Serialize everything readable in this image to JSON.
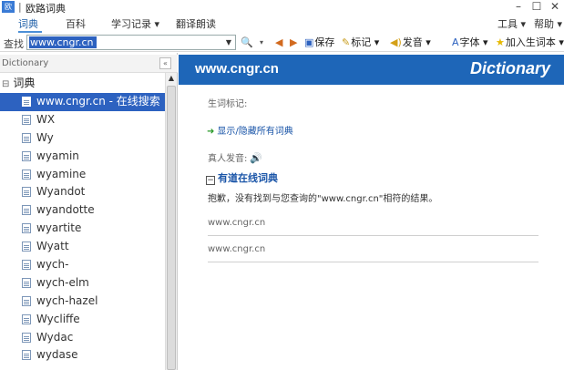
{
  "window": {
    "app_icon_text": "欧",
    "separator": "|",
    "title": "欧路词典",
    "minimize": "–",
    "maximize": "☐",
    "close": "✕"
  },
  "menubar": {
    "tabs": [
      {
        "label": "词典"
      },
      {
        "label": "百科"
      },
      {
        "label": "学习记录 ▾"
      },
      {
        "label": "翻译朗读"
      }
    ],
    "tools": "工具 ▾",
    "help": "帮助 ▾"
  },
  "toolbar": {
    "search_label": "查找",
    "search_value": "www.cngr.cn",
    "search_dropdown": "▼",
    "search_icon": "🔍",
    "search_icon_arrow": "▾",
    "back_icon": "◀",
    "forward_icon": "▶",
    "save": "保存",
    "mark": "标记 ▾",
    "pronounce": "发音 ▾",
    "font": "字体 ▾",
    "add_wordbook": "加入生词本 ▾"
  },
  "left_panel": {
    "title": "Dictionary",
    "collapse_icon": "«",
    "root_toggle": "⊟",
    "root_label": "词典",
    "items": [
      {
        "label": "www.cngr.cn - 在线搜索",
        "selected": true
      },
      {
        "label": "WX"
      },
      {
        "label": "Wy"
      },
      {
        "label": "wyamin"
      },
      {
        "label": "wyamine"
      },
      {
        "label": "Wyandot"
      },
      {
        "label": "wyandotte"
      },
      {
        "label": "wyartite"
      },
      {
        "label": "Wyatt"
      },
      {
        "label": "wych-"
      },
      {
        "label": "wych-elm"
      },
      {
        "label": "wych-hazel"
      },
      {
        "label": "Wycliffe"
      },
      {
        "label": "Wydac"
      },
      {
        "label": "wydase"
      }
    ],
    "scroll_up": "▲"
  },
  "right_panel": {
    "banner_title": "www.cngr.cn",
    "banner_brand": "Dictionary",
    "word_mark_label": "生词标记:",
    "toggle_arrow": "➜",
    "toggle_link": "显示/隐藏所有词典",
    "real_voice_label": "真人发音:",
    "speaker_icon": "🔊",
    "section_toggle": "−",
    "section_title": "有道在线词典",
    "message": "抱歉，没有找到与您查询的\"www.cngr.cn\"相符的结果。",
    "result_1": "www.cngr.cn",
    "result_2": "www.cngr.cn"
  },
  "colors": {
    "banner": "#1e66b8",
    "selection": "#2d62c0",
    "link": "#1a55a8"
  }
}
